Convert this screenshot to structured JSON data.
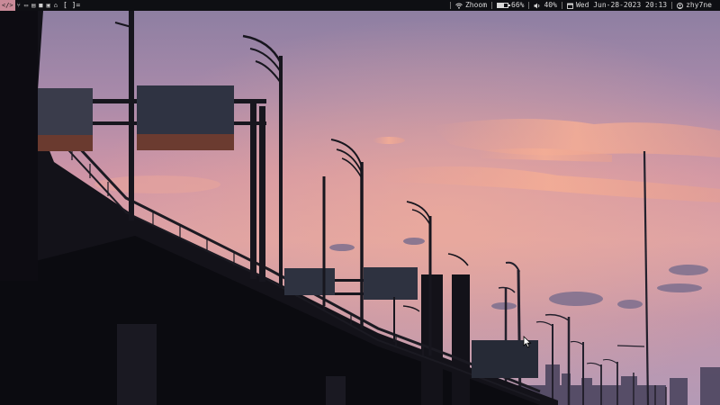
{
  "colors": {
    "bar_bg": "#0e0f13",
    "bar_fg": "#d8d8d8",
    "active_ws": "#c98a98",
    "sky_top": "#8d7ea0",
    "sky_mid": "#c891a6",
    "sky_glow": "#e8a596",
    "sky_low": "#b89ab4",
    "silhouette": "#14131a"
  },
  "topbar": {
    "workspaces": [
      {
        "icon": "code-icon",
        "glyph": "</>",
        "active": true
      },
      {
        "icon": "git-icon",
        "glyph": "⑂",
        "active": false
      },
      {
        "icon": "monitor-icon",
        "glyph": "▭",
        "active": false
      },
      {
        "icon": "folder-icon",
        "glyph": "▤",
        "active": false
      },
      {
        "icon": "video-icon",
        "glyph": "■",
        "active": false
      },
      {
        "icon": "chat-icon",
        "glyph": "▣",
        "active": false
      },
      {
        "icon": "home-icon",
        "glyph": "⌂",
        "active": false
      }
    ],
    "layout_indicator": "[ ]=",
    "wifi": {
      "icon": "wifi-icon",
      "label": "Zhoom"
    },
    "battery": {
      "icon": "battery-icon",
      "label": "66%",
      "level": 0.66
    },
    "volume": {
      "icon": "volume-icon",
      "label": "40%"
    },
    "datetime": {
      "icon": "calendar-icon",
      "label": "Wed Jun-28-2023 20:13"
    },
    "user": {
      "icon": "user-icon",
      "label": "zhy7ne"
    }
  }
}
